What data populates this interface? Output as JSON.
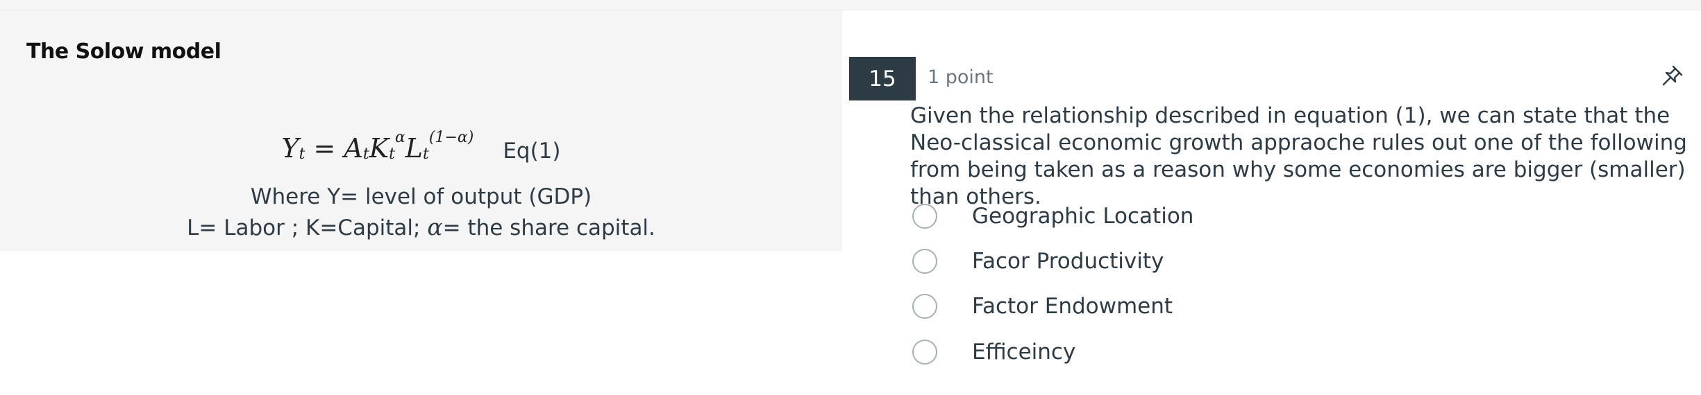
{
  "left_panel": {
    "title": "The Solow model",
    "equation_label": "Eq(1)",
    "where_line": "Where Y= level of output (GDP)",
    "definitions_prefix": "L= Labor ; K=Capital; ",
    "alpha_symbol": "α",
    "definitions_suffix": "= the share capital."
  },
  "question": {
    "number": "15",
    "points": "1 point",
    "text": "Given the relationship described in equation (1), we can state that the Neo-classical economic growth appraoche rules out one of the following from being taken as a reason why some economies are bigger (smaller) than others.",
    "options": [
      {
        "label": "Geographic Location",
        "selected": false
      },
      {
        "label": "Facor Productivity",
        "selected": false
      },
      {
        "label": "Factor Endowment",
        "selected": false
      },
      {
        "label": "Efficeincy",
        "selected": false
      }
    ],
    "pin_icon": "pin-icon"
  }
}
